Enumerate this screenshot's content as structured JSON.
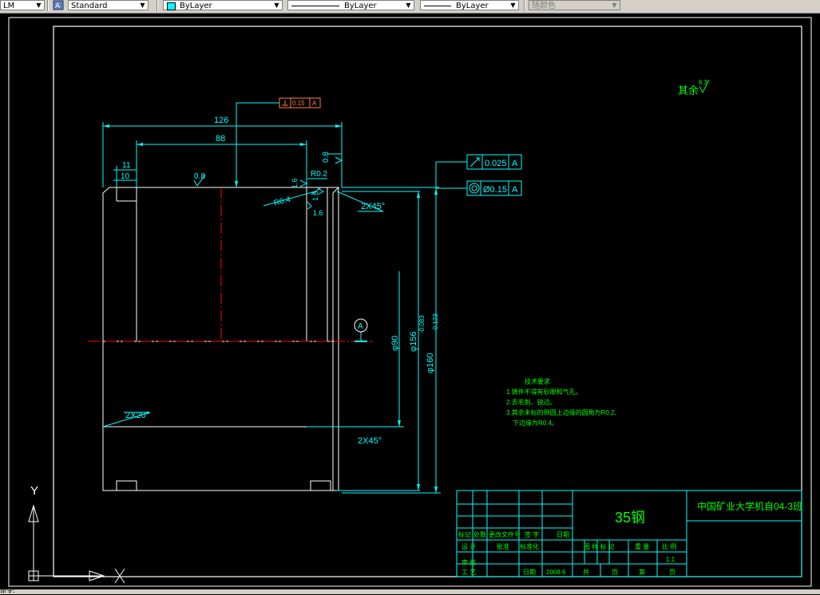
{
  "toolbar": {
    "layer_value": "LM",
    "textstyle_value": "Standard",
    "color_value": "ByLayer",
    "linetype_value": "ByLayer",
    "lineweight_value": "ByLayer",
    "plotstyle_value": "随颜色"
  },
  "drawing": {
    "dim_126": "126",
    "dim_88": "88",
    "dim_11": "11",
    "dim_10": "10",
    "rough_08a": "0.8",
    "rough_08b": "0.8",
    "rough_16a": "1.6",
    "rough_16b": "1.6",
    "rough_16c": "1.6",
    "r02": "R0.2",
    "r04": "R0.4",
    "chamfer_top": "2X45°",
    "chamfer_bottom": "2X45°",
    "chamfer_left": "2X20°",
    "dia_90": "φ90",
    "dia_156": "φ156",
    "dia_160": "φ160",
    "tol_upper": "-0.083",
    "tol_lower": "-0.123",
    "datum_letter": "A",
    "rest_rough_label": "其余",
    "rest_rough_value": "6.3"
  },
  "fcf": {
    "perp_value": "0.15",
    "perp_datum": "A",
    "runout_value": "0.025",
    "runout_datum": "A",
    "conc_value": "Ø0.15",
    "conc_datum": "A"
  },
  "notes": {
    "title": "技术要求",
    "line1": "1.铸件不得有砂眼和气孔。",
    "line2": "2.去毛刺、锐边。",
    "line3": "3.其余未标的倒圆上边缘的圆角为R0.2,",
    "line4": "下边缘为R0.4。"
  },
  "titleblock": {
    "material": "35钢",
    "school": "中国矿业大学机自04-3班",
    "h_mark": "标记",
    "h_count": "处数",
    "h_change_doc": "更改文件号",
    "h_sign": "签 字",
    "h_date": "日期",
    "r_design": "设 计",
    "r_check": "审 核",
    "r_craft": "工 艺",
    "r_std": "标准化",
    "r_approve": "批准",
    "date_label": "日期",
    "date_value": "2008.6",
    "h_stage": "图 样 标 记",
    "h_weight": "重 量",
    "h_scale": "比 例",
    "scale_value": "1:1",
    "sheet_total": "共",
    "sheet_unit1": "页",
    "sheet_no": "第",
    "sheet_unit2": "页"
  },
  "ucs": {
    "x_label": "X",
    "y_label": "Y"
  },
  "status": {
    "command_text": "命令:"
  },
  "colors": {
    "background": "#000000",
    "geometry": "#ffffff",
    "dimension": "#00ffff",
    "text": "#00ff00",
    "centerline": "#ff0000",
    "border": "#ffffff",
    "perp_frame": "#ff8040"
  }
}
